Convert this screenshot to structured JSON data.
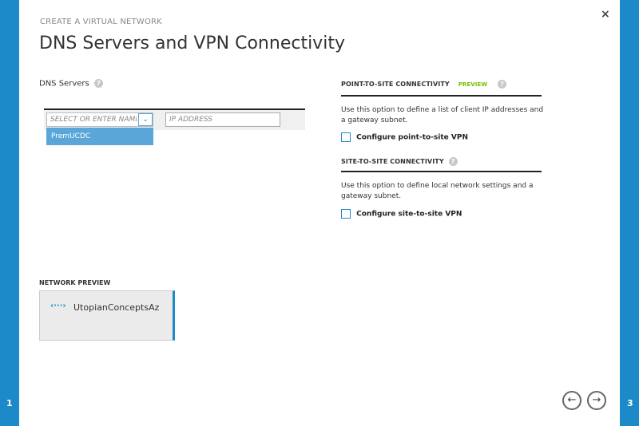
{
  "wizard": {
    "eyebrow": "CREATE A VIRTUAL NETWORK",
    "title": "DNS Servers and VPN Connectivity",
    "step_left": "1",
    "step_right": "3",
    "close_label": "×",
    "accent_color": "#1c8ac9"
  },
  "dns": {
    "label": "DNS Servers",
    "help": "?",
    "select_placeholder": "SELECT OR ENTER NAME",
    "select_chevron": "⌄",
    "ip_placeholder": "IP ADDRESS",
    "dropdown_option": "PremUCDC"
  },
  "point_to_site": {
    "heading": "POINT-TO-SITE CONNECTIVITY",
    "badge": "PREVIEW",
    "help": "?",
    "description": "Use this option to define a list of client IP addresses and a gateway subnet.",
    "checkbox_label": "Configure point-to-site VPN",
    "checked": false
  },
  "site_to_site": {
    "heading": "SITE-TO-SITE CONNECTIVITY",
    "help": "?",
    "description": "Use this option to define local network settings and a gateway subnet.",
    "checkbox_label": "Configure site-to-site VPN",
    "checked": false
  },
  "network_preview": {
    "label": "NETWORK PREVIEW",
    "icon": "‹···›",
    "network_name": "UtopianConceptsAz"
  },
  "nav": {
    "back": "←",
    "next": "→"
  }
}
